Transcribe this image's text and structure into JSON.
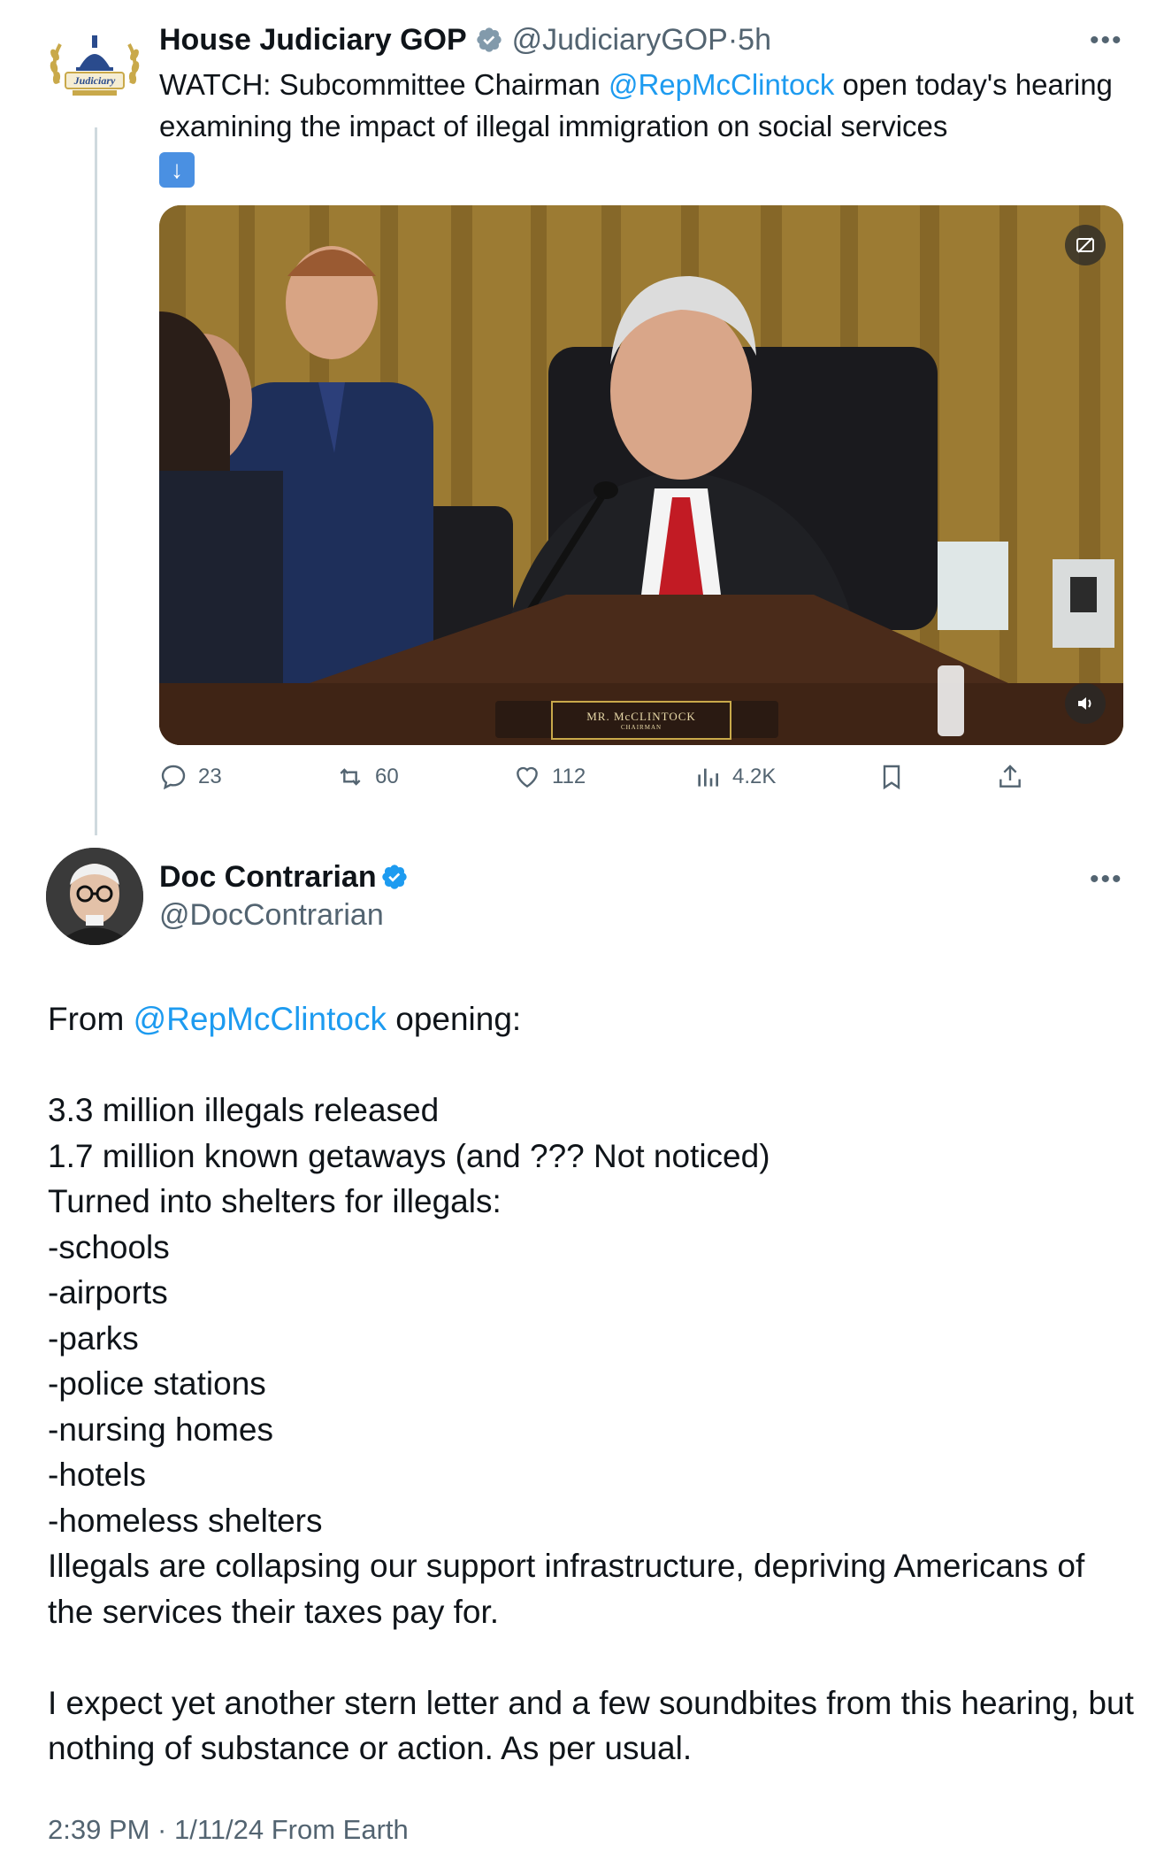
{
  "tweet1": {
    "display_name": "House Judiciary GOP",
    "handle": "@JudiciaryGOP",
    "separator": "·",
    "time_ago": "5h",
    "logo_text": "Judiciary",
    "text_prefix": "WATCH: Subcommittee Chairman ",
    "mention": "@RepMcClintock",
    "text_suffix": " open today's hearing examining the impact of illegal immigration on social services",
    "emoji": "⬇️",
    "video": {
      "nameplate_name": "MR. McCLINTOCK",
      "nameplate_title": "CHAIRMAN"
    },
    "stats": {
      "replies": "23",
      "reposts": "60",
      "likes": "112",
      "views": "4.2K"
    }
  },
  "tweet2": {
    "display_name": "Doc Contrarian",
    "handle": "@DocContrarian",
    "body_prefix": "From ",
    "mention": "@RepMcClintock",
    "body_first_line_suffix": " opening:",
    "body_lines": [
      "",
      "3.3 million illegals released",
      "1.7 million known getaways (and ??? Not noticed)",
      "Turned into shelters for illegals:",
      "-schools",
      "-airports",
      "-parks",
      "-police stations",
      "-nursing homes",
      "-hotels",
      "-homeless shelters",
      "Illegals are collapsing our support infrastructure, depriving Americans of the services their taxes pay for.",
      "",
      "I expect yet another stern letter and a few soundbites from this hearing, but nothing of substance or action. As per usual."
    ],
    "footer": "2:39 PM · 1/11/24 From Earth"
  },
  "colors": {
    "link": "#1d9bf0",
    "muted": "#536471",
    "text": "#0f1419",
    "gold_verified": "#829aab"
  }
}
